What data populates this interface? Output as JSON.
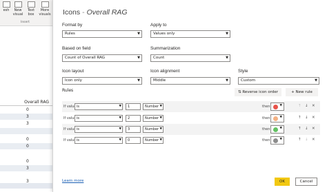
{
  "ribbon": {
    "buttons": [
      {
        "label": "esh"
      },
      {
        "label": "New visual"
      },
      {
        "label": "Text box"
      },
      {
        "label": "More visuals"
      }
    ],
    "group_label": "Insert"
  },
  "table": {
    "header": "Overall RAG",
    "rows": [
      "0",
      "3",
      "3",
      "",
      "0",
      "0",
      "",
      "0",
      "3",
      "",
      "3"
    ]
  },
  "dialog": {
    "title_prefix": "Icons",
    "title_separator": "-",
    "title_field": "Overall RAG",
    "format_by_label": "Format by",
    "format_by_value": "Rules",
    "apply_to_label": "Apply to",
    "apply_to_value": "Values only",
    "based_on_label": "Based on field",
    "based_on_value": "Count of Overall RAG",
    "summarization_label": "Summarization",
    "summarization_value": "Count",
    "icon_layout_label": "Icon layout",
    "icon_layout_value": "Icon only",
    "icon_alignment_label": "Icon alignment",
    "icon_alignment_value": "Middle",
    "style_label": "Style",
    "style_value": "Custom",
    "rules_label": "Rules",
    "reverse_btn": "Reverse icon order",
    "new_rule_btn": "New rule",
    "learn_more": "Learn more",
    "ok": "OK",
    "cancel": "Cancel"
  },
  "rules": [
    {
      "if_value": "If value",
      "op": "is",
      "value": "1",
      "type": "Number",
      "then": "then",
      "color": "#e8534a"
    },
    {
      "if_value": "If value",
      "op": "is",
      "value": "2",
      "type": "Number",
      "then": "then",
      "color": "#f4b183"
    },
    {
      "if_value": "If value",
      "op": "is",
      "value": "3",
      "type": "Number",
      "then": "then",
      "color": "#63c163"
    },
    {
      "if_value": "If value",
      "op": "is",
      "value": "0",
      "type": "Number",
      "then": "then",
      "color": "#8c8c8c"
    }
  ]
}
